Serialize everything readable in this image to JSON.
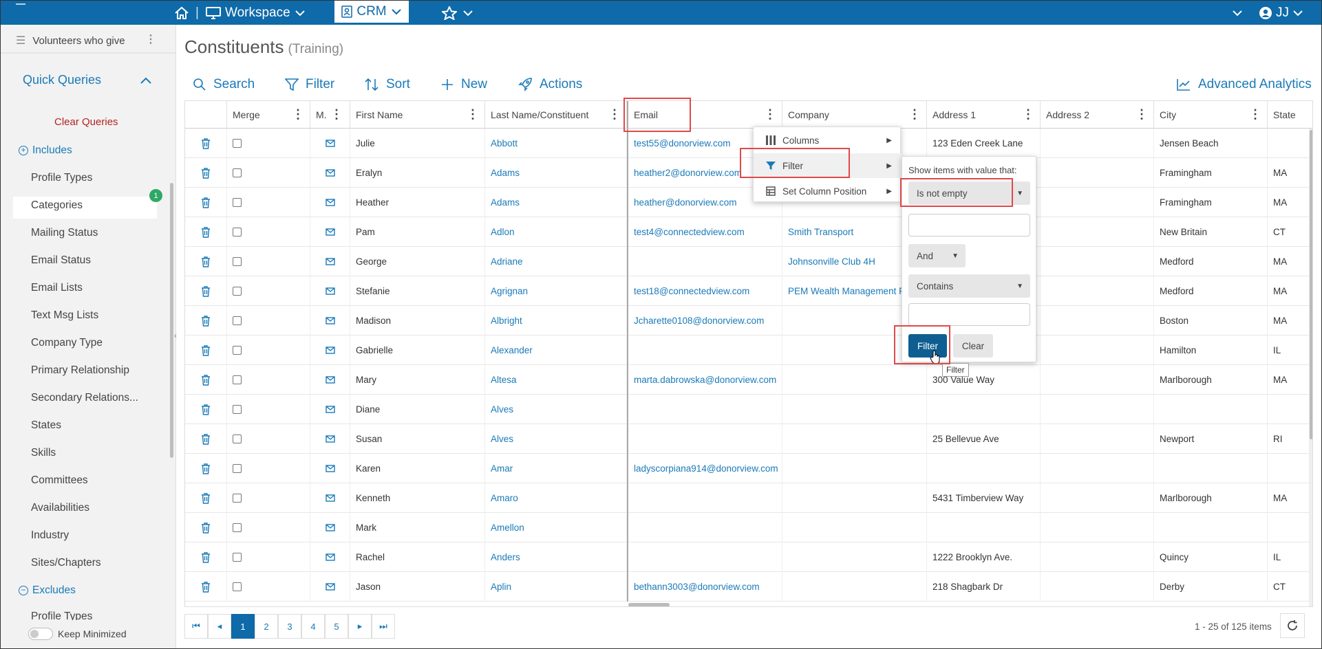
{
  "topbar": {
    "workspace_label": "Workspace",
    "crm_label": "CRM",
    "user_initials": "JJ"
  },
  "sidebar": {
    "saved_query": "Volunteers who give",
    "quick_queries_title": "Quick Queries",
    "clear_queries": "Clear Queries",
    "includes_label": "Includes",
    "excludes_label": "Excludes",
    "categories_badge": "1",
    "items": [
      "Profile Types",
      "Categories",
      "Mailing Status",
      "Email Status",
      "Email Lists",
      "Text Msg Lists",
      "Company Type",
      "Primary Relationship",
      "Secondary Relations...",
      "States",
      "Skills",
      "Committees",
      "Availabilities",
      "Industry",
      "Sites/Chapters"
    ],
    "excludes_first_item": "Profile Types",
    "keep_minimized": "Keep Minimized"
  },
  "main": {
    "title": "Constituents",
    "subtitle": "(Training)",
    "toolbar": {
      "search": "Search",
      "filter": "Filter",
      "sort": "Sort",
      "new": "New",
      "actions": "Actions",
      "analytics": "Advanced Analytics"
    }
  },
  "grid": {
    "columns": [
      "Merge",
      "M.",
      "First Name",
      "Last Name/Constituent",
      "Email",
      "Company",
      "Address 1",
      "Address 2",
      "City",
      "State"
    ],
    "rows": [
      [
        "Julie",
        "Abbott",
        "test55@donorview.com",
        "",
        "123 Eden Creek Lane",
        "",
        "Jensen Beach",
        ""
      ],
      [
        "Eralyn",
        "Adams",
        "heather2@donorview.com",
        "",
        "",
        "",
        "Framingham",
        "MA"
      ],
      [
        "Heather",
        "Adams",
        "heather@donorview.com",
        "",
        "",
        "",
        "Framingham",
        "MA"
      ],
      [
        "Pam",
        "Adlon",
        "test4@connectedview.com",
        "Smith Transport",
        "",
        "",
        "New Britain",
        "CT"
      ],
      [
        "George",
        "Adriane",
        "",
        "Johnsonville Club 4H",
        "",
        "",
        "Medford",
        "MA"
      ],
      [
        "Stefanie",
        "Agrignan",
        "test18@connectedview.com",
        "PEM Wealth Management F",
        "",
        "",
        "Medford",
        "MA"
      ],
      [
        "Madison",
        "Albright",
        "Jcharette0108@donorview.com",
        "",
        "",
        "",
        "Boston",
        "MA"
      ],
      [
        "Gabrielle",
        "Alexander",
        "",
        "",
        "",
        "",
        "Hamilton",
        "IL"
      ],
      [
        "Mary",
        "Altesa",
        "marta.dabrowska@donorview.com",
        "",
        "300 Value Way",
        "",
        "Marlborough",
        "MA"
      ],
      [
        "Diane",
        "Alves",
        "",
        "",
        "",
        "",
        "",
        ""
      ],
      [
        "Susan",
        "Alves",
        "",
        "",
        "25 Bellevue Ave",
        "",
        "Newport",
        "RI"
      ],
      [
        "Karen",
        "Amar",
        "ladyscorpiana914@donorview.com",
        "",
        "",
        "",
        "",
        ""
      ],
      [
        "Kenneth",
        "Amaro",
        "",
        "",
        "5431 Timberview Way",
        "",
        "Marlborough",
        "MA"
      ],
      [
        "Mark",
        "Amellon",
        "",
        "",
        "",
        "",
        "",
        ""
      ],
      [
        "Rachel",
        "Anders",
        "",
        "",
        "1222 Brooklyn Ave.",
        "",
        "Quincy",
        "IL"
      ],
      [
        "Jason",
        "Aplin",
        "bethann3003@donorview.com",
        "",
        "218 Shagbark Dr",
        "",
        "Derby",
        "CT"
      ]
    ]
  },
  "column_menu": {
    "columns": "Columns",
    "filter": "Filter",
    "set_position": "Set Column Position"
  },
  "filter_panel": {
    "prompt": "Show items with value that:",
    "operator1": "Is not empty",
    "logic": "And",
    "operator2": "Contains",
    "filter_button": "Filter",
    "clear_button": "Clear",
    "tooltip": "Filter"
  },
  "pager": {
    "pages": [
      "1",
      "2",
      "3",
      "4",
      "5"
    ],
    "summary": "1 - 25 of 125 items"
  },
  "colors": {
    "brand": "#0e6aa8",
    "link": "#1a7ab8",
    "highlight": "#e04848",
    "badge": "#2fa866"
  }
}
